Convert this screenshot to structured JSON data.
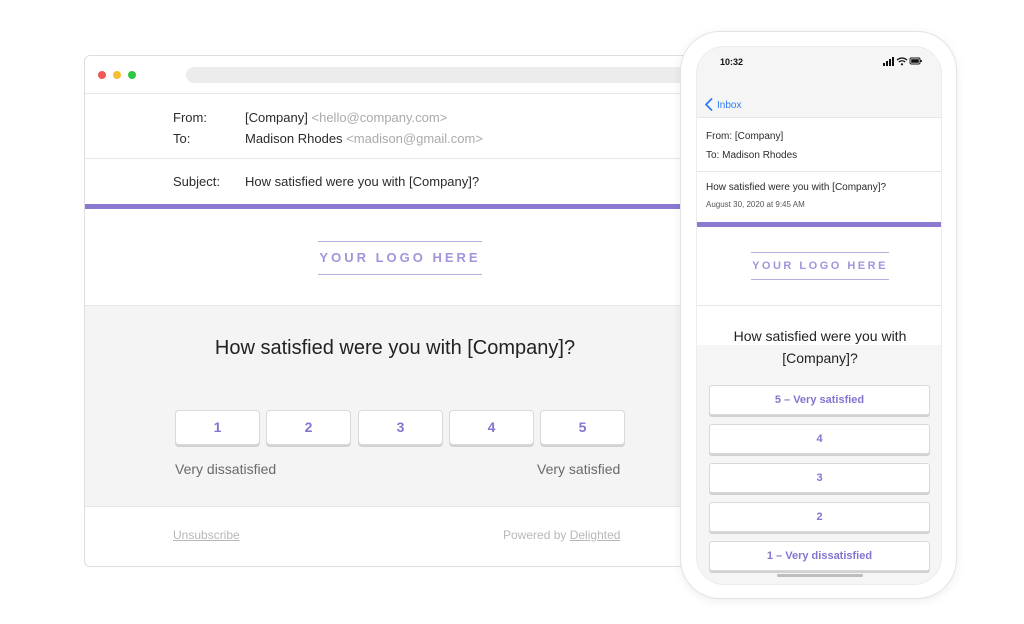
{
  "desktop": {
    "from_label": "From:",
    "from_name": "[Company]",
    "from_email": "<hello@company.com>",
    "to_label": "To:",
    "to_name": "Madison Rhodes",
    "to_email": "<madison@gmail.com>",
    "subject_label": "Subject:",
    "subject": "How satisfied were you with [Company]?",
    "logo_text": "YOUR LOGO HERE",
    "question": "How satisfied were you with [Company]?",
    "ratings": [
      "1",
      "2",
      "3",
      "4",
      "5"
    ],
    "low_label": "Very dissatisfied",
    "high_label": "Very satisfied",
    "unsubscribe": "Unsubscribe",
    "powered_by": "Powered by",
    "powered_link": "Delighted"
  },
  "mobile": {
    "time": "10:32",
    "back_label": "Inbox",
    "from": "From: [Company]",
    "to": "To: Madison Rhodes",
    "subject": "How satisfied were you with [Company]?",
    "date": "August 30, 2020 at 9:45 AM",
    "logo_text": "YOUR LOGO HERE",
    "question": "How satisfied were you with [Company]?",
    "options": [
      "5 – Very satisfied",
      "4",
      "3",
      "2",
      "1 – Very dissatisfied"
    ]
  },
  "colors": {
    "accent": "#8c79d1",
    "rating_text": "#8574cf",
    "link_blue": "#2e7cf6"
  },
  "icons": [
    "back-chevron-icon",
    "signal-icon",
    "wifi-icon",
    "battery-icon"
  ]
}
